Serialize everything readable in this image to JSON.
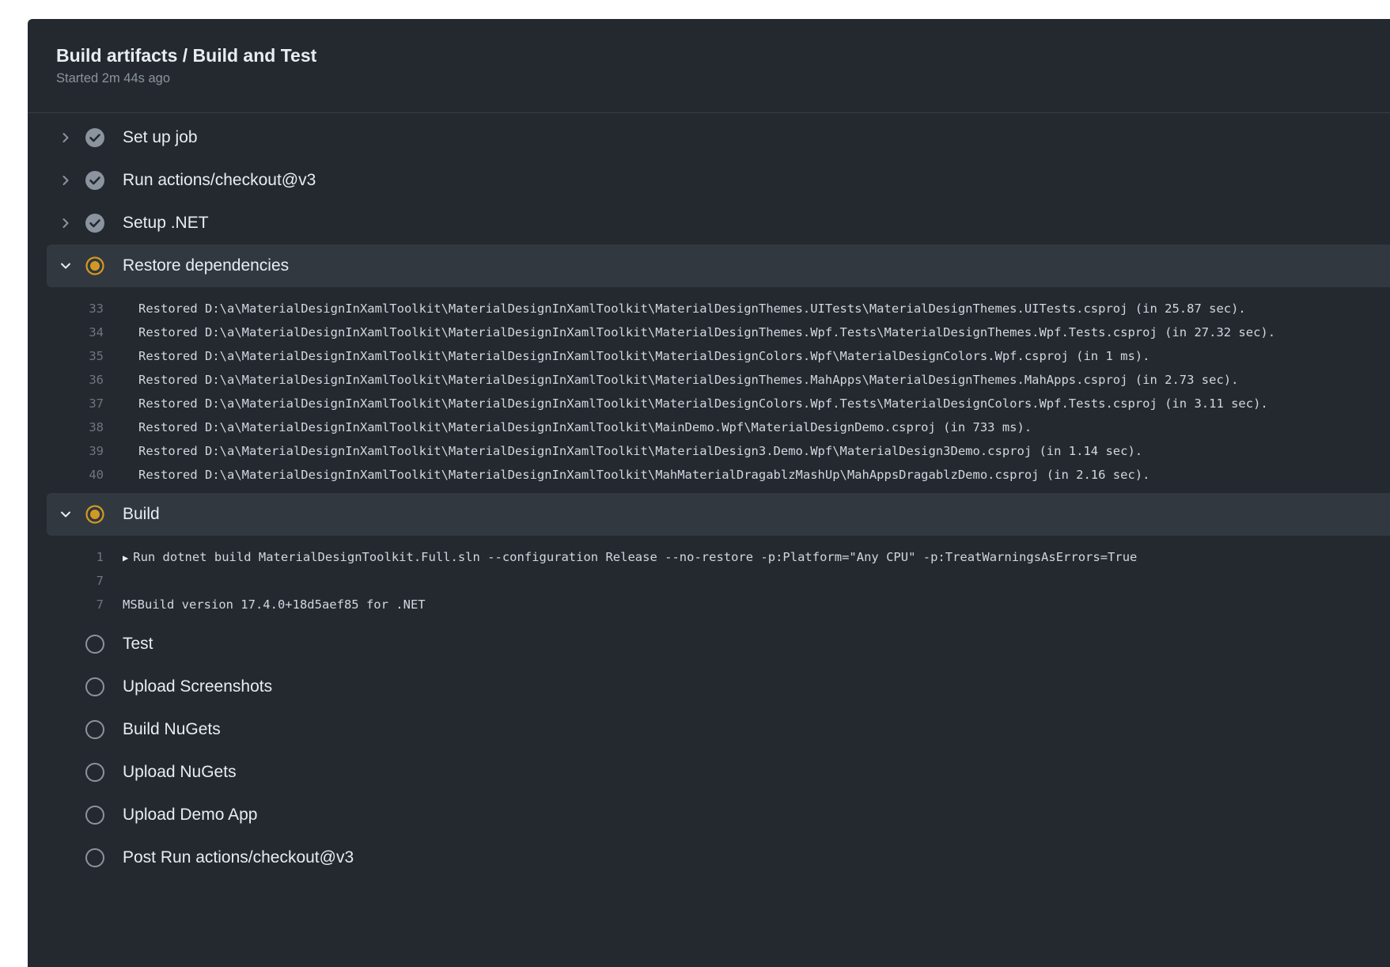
{
  "header": {
    "title": "Build artifacts / Build and Test",
    "subtitle": "Started 2m 44s ago"
  },
  "colors": {
    "panel": "#24292f",
    "success": "#8b949e",
    "in_progress": "#d29922",
    "pending": "#8b949e"
  },
  "steps_before": [
    {
      "label": "Set up job",
      "status": "success"
    },
    {
      "label": "Run actions/checkout@v3",
      "status": "success"
    },
    {
      "label": "Setup .NET",
      "status": "success"
    }
  ],
  "restore": {
    "label": "Restore dependencies",
    "lines": [
      {
        "n": "33",
        "text": "Restored D:\\a\\MaterialDesignInXamlToolkit\\MaterialDesignInXamlToolkit\\MaterialDesignThemes.UITests\\MaterialDesignThemes.UITests.csproj (in 25.87 sec)."
      },
      {
        "n": "34",
        "text": "Restored D:\\a\\MaterialDesignInXamlToolkit\\MaterialDesignInXamlToolkit\\MaterialDesignThemes.Wpf.Tests\\MaterialDesignThemes.Wpf.Tests.csproj (in 27.32 sec)."
      },
      {
        "n": "35",
        "text": "Restored D:\\a\\MaterialDesignInXamlToolkit\\MaterialDesignInXamlToolkit\\MaterialDesignColors.Wpf\\MaterialDesignColors.Wpf.csproj (in 1 ms)."
      },
      {
        "n": "36",
        "text": "Restored D:\\a\\MaterialDesignInXamlToolkit\\MaterialDesignInXamlToolkit\\MaterialDesignThemes.MahApps\\MaterialDesignThemes.MahApps.csproj (in 2.73 sec)."
      },
      {
        "n": "37",
        "text": "Restored D:\\a\\MaterialDesignInXamlToolkit\\MaterialDesignInXamlToolkit\\MaterialDesignColors.Wpf.Tests\\MaterialDesignColors.Wpf.Tests.csproj (in 3.11 sec)."
      },
      {
        "n": "38",
        "text": "Restored D:\\a\\MaterialDesignInXamlToolkit\\MaterialDesignInXamlToolkit\\MainDemo.Wpf\\MaterialDesignDemo.csproj (in 733 ms)."
      },
      {
        "n": "39",
        "text": "Restored D:\\a\\MaterialDesignInXamlToolkit\\MaterialDesignInXamlToolkit\\MaterialDesign3.Demo.Wpf\\MaterialDesign3Demo.csproj (in 1.14 sec)."
      },
      {
        "n": "40",
        "text": "Restored D:\\a\\MaterialDesignInXamlToolkit\\MaterialDesignInXamlToolkit\\MahMaterialDragablzMashUp\\MahAppsDragablzDemo.csproj (in 2.16 sec)."
      }
    ]
  },
  "build": {
    "label": "Build",
    "lines": [
      {
        "n": "1",
        "text": "Run dotnet build MaterialDesignToolkit.Full.sln --configuration Release --no-restore -p:Platform=\"Any CPU\" -p:TreatWarningsAsErrors=True",
        "collapsible": true
      },
      {
        "n": "7",
        "text": ""
      },
      {
        "n": "7",
        "text": "MSBuild version 17.4.0+18d5aef85 for .NET"
      }
    ]
  },
  "steps_after": [
    {
      "label": "Test",
      "status": "pending"
    },
    {
      "label": "Upload Screenshots",
      "status": "pending"
    },
    {
      "label": "Build NuGets",
      "status": "pending"
    },
    {
      "label": "Upload NuGets",
      "status": "pending"
    },
    {
      "label": "Upload Demo App",
      "status": "pending"
    },
    {
      "label": "Post Run actions/checkout@v3",
      "status": "pending"
    }
  ]
}
